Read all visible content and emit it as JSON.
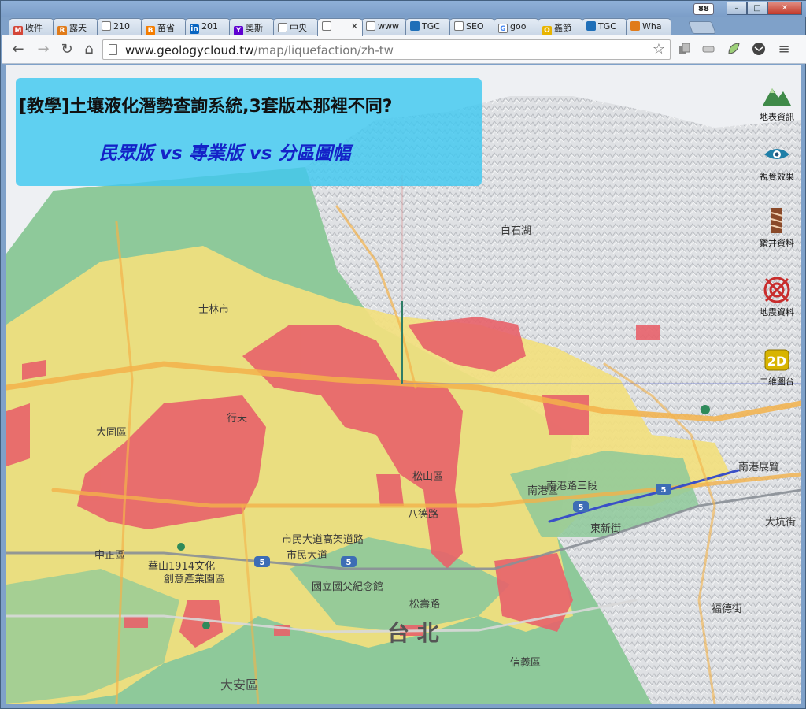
{
  "window": {
    "badge": "88",
    "minimize": "–",
    "maximize": "□",
    "close": "✕"
  },
  "tabs": [
    {
      "label": "收件",
      "icon": "gmail-icon",
      "color": "#d44638",
      "glyph": "M"
    },
    {
      "label": "露天",
      "icon": "ruten-icon",
      "color": "#e07b1a",
      "glyph": "R"
    },
    {
      "label": "210",
      "icon": "page-icon",
      "color": "#ffffff",
      "glyph": ""
    },
    {
      "label": "苗省",
      "icon": "blogger-icon",
      "color": "#f57d00",
      "glyph": "B"
    },
    {
      "label": "201",
      "icon": "linkedin-icon",
      "color": "#0a66c2",
      "glyph": "in"
    },
    {
      "label": "奧斯",
      "icon": "yahoo-icon",
      "color": "#5f01d1",
      "glyph": "Y"
    },
    {
      "label": "中央",
      "icon": "page-icon",
      "color": "#ffffff",
      "glyph": ""
    },
    {
      "label": " ",
      "icon": "page-icon",
      "color": "#ffffff",
      "glyph": "",
      "active": true
    },
    {
      "label": "www",
      "icon": "page-icon",
      "color": "#ffffff",
      "glyph": ""
    },
    {
      "label": "TGC",
      "icon": "tgc-icon",
      "color": "#1f6fb8",
      "glyph": ""
    },
    {
      "label": "SEO",
      "icon": "page-icon",
      "color": "#ffffff",
      "glyph": ""
    },
    {
      "label": "goo",
      "icon": "google-icon",
      "color": "#ffffff",
      "glyph": "G"
    },
    {
      "label": "鑫節",
      "icon": "ring-icon",
      "color": "#e8b400",
      "glyph": "O"
    },
    {
      "label": "TGC",
      "icon": "tgc-icon",
      "color": "#1f6fb8",
      "glyph": ""
    },
    {
      "label": "Wha",
      "icon": "whatsapp-icon",
      "color": "#e07b1a",
      "glyph": ""
    }
  ],
  "toolbar": {
    "back": "←",
    "forward": "→",
    "reload": "↻",
    "home": "⌂",
    "url_host": "www.geologycloud.tw",
    "url_path": "/map/liquefaction/zh-tw",
    "star": "☆",
    "menu": "≡"
  },
  "banner": {
    "title": "[教學]土壤液化潛勢查詢系統,3套版本那裡不同?",
    "subtitle": "民眾版 vs  專業版 vs  分區圖幅"
  },
  "side_tools": [
    {
      "label": "地表資訊",
      "icon": "mountain-icon"
    },
    {
      "label": "視覺效果",
      "icon": "eye-icon"
    },
    {
      "label": "鑽井資料",
      "icon": "drill-icon"
    },
    {
      "label": "地震資料",
      "icon": "target-icon"
    },
    {
      "label": "二維圖台",
      "icon": "2d-icon",
      "glyph": "2D"
    }
  ],
  "map_labels": [
    {
      "text": "行天",
      "cls": ""
    },
    {
      "text": "松山區",
      "cls": ""
    },
    {
      "text": "中正區",
      "cls": ""
    },
    {
      "text": "華山1914文化",
      "cls": ""
    },
    {
      "text": "創意產業園區",
      "cls": ""
    },
    {
      "text": "國立國父紀念館",
      "cls": ""
    },
    {
      "text": "松壽路",
      "cls": ""
    },
    {
      "text": "台 北",
      "cls": "big"
    },
    {
      "text": "大安區",
      "cls": "mid"
    },
    {
      "text": "信義區",
      "cls": ""
    },
    {
      "text": "南港區",
      "cls": ""
    },
    {
      "text": "東新街",
      "cls": ""
    },
    {
      "text": "白石湖",
      "cls": ""
    },
    {
      "text": "大同區",
      "cls": ""
    },
    {
      "text": "南港展覽",
      "cls": ""
    },
    {
      "text": "市民大道高架道路",
      "cls": ""
    },
    {
      "text": "市民大道",
      "cls": ""
    },
    {
      "text": "八德路",
      "cls": ""
    },
    {
      "text": "南港路三段",
      "cls": ""
    },
    {
      "text": "大坑街",
      "cls": ""
    },
    {
      "text": "福德街",
      "cls": ""
    },
    {
      "text": "士林市",
      "cls": ""
    }
  ],
  "colors": {
    "high": "#e8626a",
    "mid": "#f2e07e",
    "low": "#8ec99a",
    "mountain": "#d9dbde",
    "banner": "#40c8f0",
    "subtitle": "#1422c8"
  }
}
